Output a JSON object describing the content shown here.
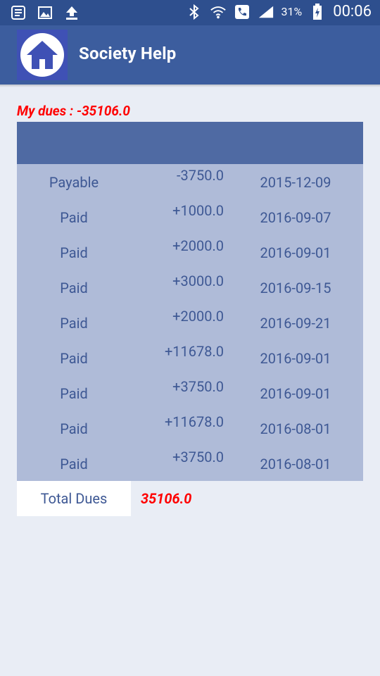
{
  "status_bar": {
    "icons_left": [
      "notes-icon",
      "image-icon",
      "upload-icon"
    ],
    "icons_right": [
      "bluetooth-icon",
      "wifi-call-icon",
      "phone-icon",
      "signal-icon",
      "battery-charging-icon"
    ],
    "battery_percent": "31%",
    "time": "00:06"
  },
  "toolbar": {
    "title": "Society Help",
    "logo_icon": "home-icon"
  },
  "dues": {
    "label": "My dues : -35106.0"
  },
  "table": {
    "rows": [
      {
        "status": "Payable",
        "amount": "-3750.0",
        "date": "2015-12-09"
      },
      {
        "status": "Paid",
        "amount": "+1000.0",
        "date": "2016-09-07"
      },
      {
        "status": "Paid",
        "amount": "+2000.0",
        "date": "2016-09-01"
      },
      {
        "status": "Paid",
        "amount": "+3000.0",
        "date": "2016-09-15"
      },
      {
        "status": "Paid",
        "amount": "+2000.0",
        "date": "2016-09-21"
      },
      {
        "status": "Paid",
        "amount": "+11678.0",
        "date": "2016-09-01"
      },
      {
        "status": "Paid",
        "amount": "+3750.0",
        "date": "2016-09-01"
      },
      {
        "status": "Paid",
        "amount": "+11678.0",
        "date": "2016-08-01"
      },
      {
        "status": "Paid",
        "amount": "+3750.0",
        "date": "2016-08-01"
      }
    ]
  },
  "total": {
    "label": "Total Dues",
    "value": "35106.0"
  },
  "colors": {
    "status_bar": "#2e4f8e",
    "toolbar": "#3c5d9e",
    "table_header": "#4f6aa3",
    "table_body": "#afbbd8",
    "text": "#3e5894",
    "accent_red": "#ff0000",
    "background": "#e9edf5"
  }
}
